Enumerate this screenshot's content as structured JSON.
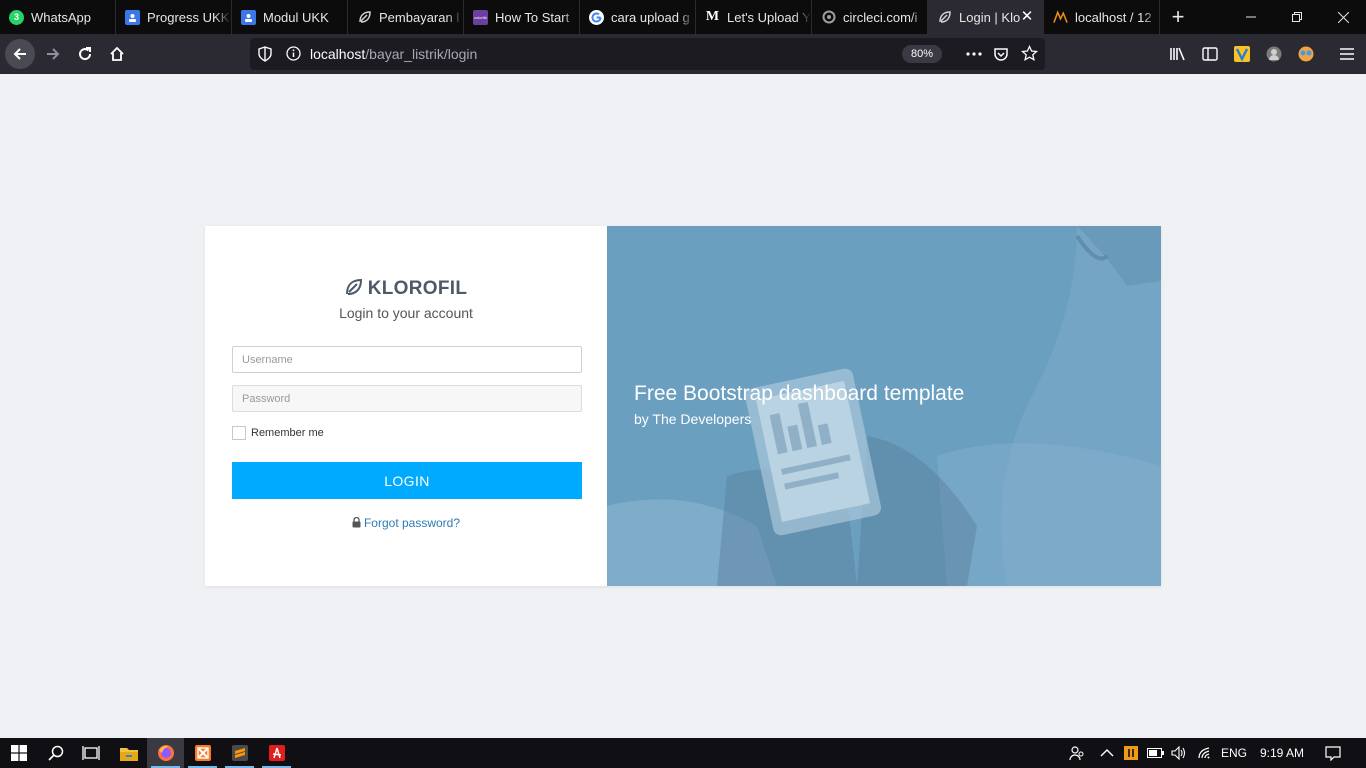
{
  "browser": {
    "tabs": [
      {
        "title": "WhatsApp",
        "icon": "whatsapp-icon",
        "badge": "3",
        "color": "#25d366"
      },
      {
        "title": "Progress UKK",
        "icon": "google-classroom-icon",
        "color": "#3b78e7"
      },
      {
        "title": "Modul UKK",
        "icon": "google-classroom-icon",
        "color": "#3b78e7"
      },
      {
        "title": "Pembayaran l",
        "icon": "klorofil-leaf-icon",
        "color": "#cfd3da"
      },
      {
        "title": "How To Start",
        "icon": "colorlib-icon",
        "badge": "colorlib",
        "color": "#6b3fa0"
      },
      {
        "title": "cara upload g",
        "icon": "google-icon",
        "color": "#ffffff"
      },
      {
        "title": "Let's Upload Y",
        "icon": "medium-icon",
        "badge": "M",
        "color": "#ffffff"
      },
      {
        "title": "circleci.com/i",
        "icon": "circleci-icon",
        "color": "#9e9e9e"
      },
      {
        "title": "Login | Klo",
        "icon": "klorofil-leaf-icon",
        "color": "#cfd3da",
        "active": true
      },
      {
        "title": "localhost / 12",
        "icon": "phpmyadmin-icon",
        "color": "#f29111"
      }
    ],
    "new_tab_label": "+",
    "url": {
      "host": "localhost",
      "path": "/bayar_listrik/login"
    },
    "zoom": "80%",
    "accent": "#00aaff"
  },
  "login": {
    "brand": "KLOROFIL",
    "subtitle": "Login to your account",
    "username_placeholder": "Username",
    "password_placeholder": "Password",
    "remember_label": "Remember me",
    "login_button": "LOGIN",
    "forgot_link": "Forgot password?"
  },
  "hero": {
    "headline": "Free Bootstrap dashboard template",
    "byline": "by The Developers",
    "overlay_color": "#6a9fc0"
  },
  "taskbar": {
    "apps": [
      "start-icon",
      "search-icon",
      "task-view-icon",
      "file-explorer-icon",
      "firefox-icon",
      "xampp-icon",
      "sublime-text-icon",
      "acrobat-icon"
    ],
    "language": "ENG",
    "time": "9:19 AM"
  }
}
